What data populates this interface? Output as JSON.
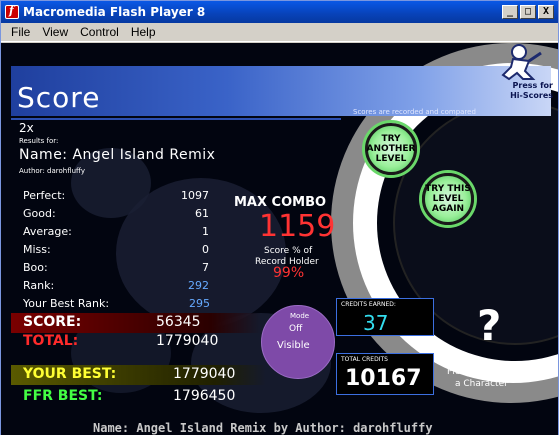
{
  "window": {
    "title": "Macromedia Flash Player 8",
    "controls": [
      "_",
      "□",
      "X"
    ]
  },
  "menu": [
    "File",
    "View",
    "Control",
    "Help"
  ],
  "header": {
    "title": "Score",
    "press_for": "Press for",
    "hi_scores": "Hi-Scores",
    "recorded_note": "Scores are recorded and compared"
  },
  "song": {
    "multiplier": "2x",
    "results_for": "Results for:",
    "name": "Name: Angel Island Remix",
    "author": "Author: darohfluffy"
  },
  "stats": [
    {
      "label": "Perfect:",
      "value": "1097"
    },
    {
      "label": "Good:",
      "value": "61"
    },
    {
      "label": "Average:",
      "value": "1"
    },
    {
      "label": "Miss:",
      "value": "0"
    },
    {
      "label": "Boo:",
      "value": "7"
    },
    {
      "label": "Rank:",
      "value": "292"
    }
  ],
  "combo": {
    "label": "MAX COMBO",
    "value": "1159",
    "score_pct_label": "Score % of",
    "record_holder": "Record Holder",
    "pct": "99%"
  },
  "best_rank": {
    "label": "Your Best Rank:",
    "value": "295"
  },
  "score": {
    "label": "SCORE:",
    "value": "56345"
  },
  "total": {
    "label": "TOTAL:",
    "value": "1779040"
  },
  "your_best": {
    "label": "YOUR BEST:",
    "value": "1779040"
  },
  "ffr_best": {
    "label": "FFR BEST:",
    "value": "1796450"
  },
  "mode": {
    "label": "Mode",
    "off": "Off",
    "visible": "Visible"
  },
  "credits": {
    "earned_label": "CREDITS EARNED:",
    "earned": "37",
    "total_label": "TOTAL CREDITS",
    "total": "10167"
  },
  "character": {
    "symbol": "?",
    "line1": "Please Choose",
    "line2": "a Character"
  },
  "buttons": {
    "try_another": "TRY ANOTHER LEVEL",
    "try_again": "TRY THIS LEVEL AGAIN"
  },
  "footer": "Name: Angel Island Remix by Author: darohfluffy",
  "colors": {
    "accent_blue": "#3a63c8",
    "score_red": "#ff2a2a",
    "combo_red": "#ff3333",
    "best_yellow": "#ffff33",
    "ffr_green": "#44ff44",
    "credits_cyan": "#33ddee",
    "rank_blue": "#66aaff",
    "mode_purple": "#7e4aa8"
  }
}
